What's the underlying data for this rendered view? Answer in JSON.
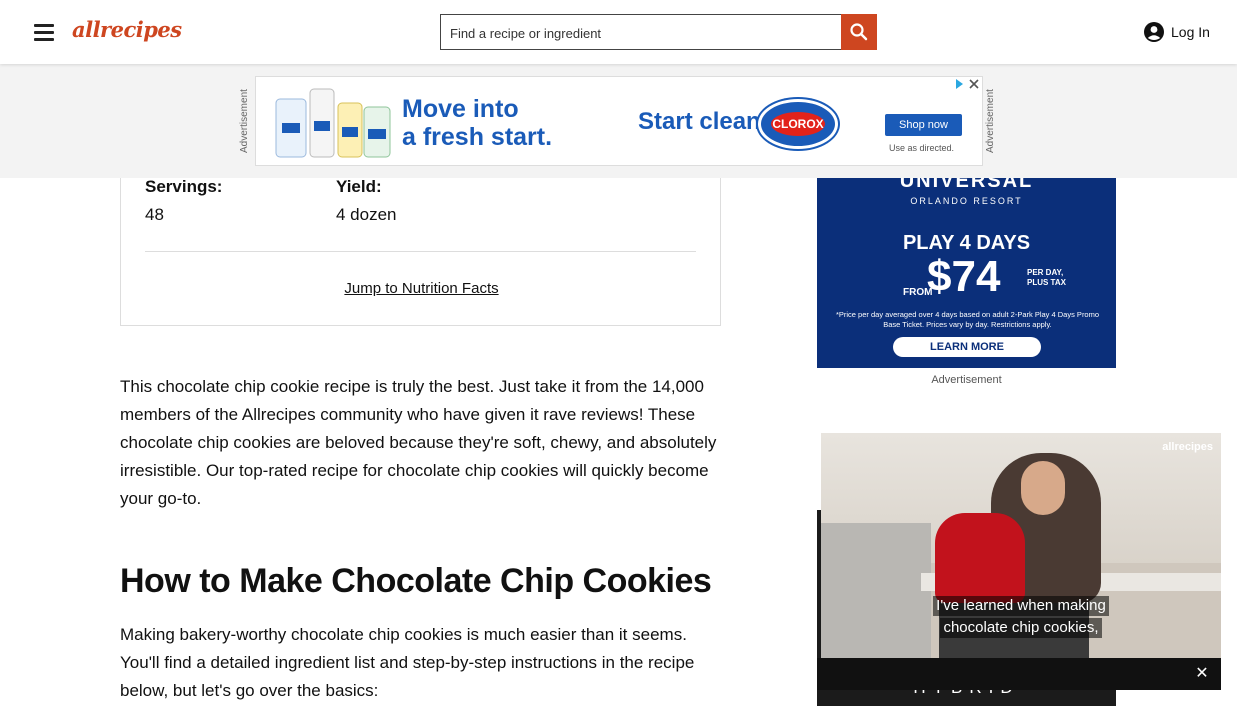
{
  "header": {
    "logo_text": "allrecipes",
    "search_placeholder": "Find a recipe or ingredient",
    "login_label": "Log In"
  },
  "top_ad": {
    "side_label": "Advertisement",
    "headline_line1": "Move into",
    "headline_line2": "a fresh start.",
    "cta_text": "Start clean.",
    "brand": "CLOROX",
    "shop_button": "Shop now",
    "disclaimer": "Use as directed."
  },
  "recipe_details": {
    "servings_label": "Servings:",
    "servings_value": "48",
    "yield_label": "Yield:",
    "yield_value": "4 dozen",
    "jump_link": "Jump to Nutrition Facts"
  },
  "article": {
    "intro": "This chocolate chip cookie recipe is truly the best. Just take it from the 14,000 members of the Allrecipes community who have given it rave reviews! These chocolate chip cookies are beloved because they're soft, chewy, and absolutely irresistible. Our top-rated recipe for chocolate chip cookies will quickly become your go-to.",
    "heading": "How to Make Chocolate Chip Cookies",
    "paragraph2": "Making bakery-worthy chocolate chip cookies is much easier than it seems. You'll find a detailed ingredient list and step-by-step instructions in the recipe below, but let's go over the basics:"
  },
  "side_ad": {
    "brand": "UNIVERSAL",
    "brand_sub": "ORLANDO RESORT",
    "headline": "PLAY 4 DAYS",
    "price_from": "FROM",
    "price": "$74",
    "price_note": "PER DAY, PLUS TAX",
    "fine_print": "*Price per day averaged over 4 days based on adult 2-Park Play 4 Days Promo Base Ticket. Prices vary by day. Restrictions apply.",
    "learn_more": "LEARN MORE",
    "label": "Advertisement"
  },
  "video": {
    "brand_tag": "allrecipes",
    "caption_line1": "I've learned when making",
    "caption_line2": "chocolate chip cookies,",
    "bg_ad_text": "HYBRID",
    "close_glyph": "✕"
  },
  "colors": {
    "brand": "#ce4620",
    "ad_blue": "#1a5bb8",
    "universal_blue": "#0b2f7a"
  }
}
